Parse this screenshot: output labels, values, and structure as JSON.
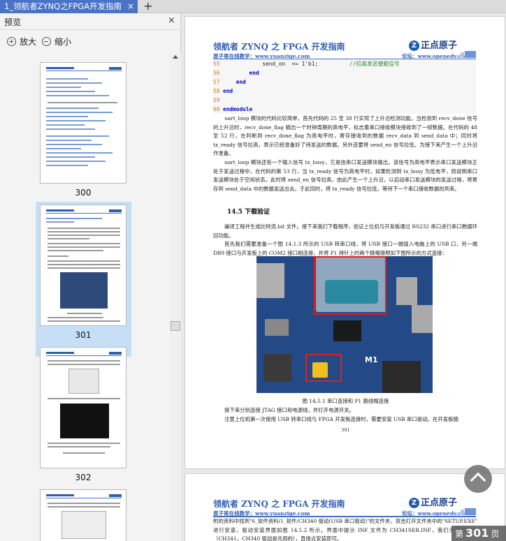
{
  "tab": {
    "title": "1_领航者ZYNQ之FPGA开发指南",
    "close": "×",
    "add": "+"
  },
  "panel": {
    "title": "预览",
    "close": "×",
    "zoom_in": "放大",
    "zoom_out": "缩小",
    "thumbnails": [
      {
        "page": "300",
        "selected": false
      },
      {
        "page": "301",
        "selected": true
      },
      {
        "page": "302",
        "selected": false
      }
    ]
  },
  "doc": {
    "header_title": "领航者 ZYNQ 之 FPGA 开发指南",
    "logo_text": "正点原子",
    "sub_left": "原子哥在线教学：www.yuanzige.com",
    "sub_right": "论坛：www.openedv.com",
    "code": [
      {
        "ln": "55",
        "text": "            send_on  <= 1'b1;",
        "comment": "//拉高发送使能信号"
      },
      {
        "ln": "56",
        "kw": "        end"
      },
      {
        "ln": "57",
        "kw": "    end"
      },
      {
        "ln": "58",
        "kw": "end"
      },
      {
        "ln": "59",
        "text": ""
      },
      {
        "ln": "60",
        "kw": "endmodule"
      }
    ],
    "para1": "uart_loop 模块的代码比较简单，首先代码的 25 至 38 行实现了上升沿检测功能。当检测到 recv_done 信号的上升沿时，recv_done_flag 输出一个时钟周期的高电平，标志着串口接收模块接收到了一帧数据。在代码的 48 至 52 行，在判断到 recv_done_flag 为高电平时，寄存接收到的数据 recv_data 到 send_data 中；同时将 tx_ready 信号拉高，表示已经准备好了待发送的数据。另外还要将 send_en 信号拉低，为接下来产生一个上升沿作准备。",
    "para2": "uart_loop 模块还有一个输入信号 tx_busy，它是由串口发送模块输出。该信号为高电平表示串口发送模块正处于发送过程中，在代码的第 53 行，当 tx_ready 信号为高电平时，如果检测到 tx_busy 为低电平，则说明串口发送模块处于空闲状态。此时将 send_en 信号拉高，由此产生一个上升沿，以启动串口发送模块的发送过程，将寄存到 send_data 中的数据发送出去。于此同时，将 tx_ready 信号拉低，等待下一个串口接收数据的到来。",
    "section": "14.5 下载验证",
    "para3": "编译工程并生成比特流.bit 文件。接下来我们下载程序，验证上位机与开发板通过 RS232 串口进行串口数据环回功能。",
    "para4": "首先我们需要准备一个图 14.1.3 所示的 USB 转串口线，将 USB 接口一端插入电脑上的 USB 口，另一端 DB9 接口与开发板上的 COM2 接口相连接，并将 P1 排针上的两个跳帽接照如下图所示的方式连接：",
    "photo_label": "M1",
    "caption": "图 14.5.1 串口连接和 P1 跳线帽连接",
    "para5": "接下来分别连接 JTAG 接口和电源线，并打开电源开关。",
    "para6": "注意上位机第一次使用 USB 转串口线与 FPGA 开发板连接时，需要安装 USB 串口驱动。在开发板随",
    "page_number": "301",
    "page2_para": "附的资料中找到\"6_软件资料/1_软件/CH340 驱动(USB 串口驱动)\"的文件夹，双击打开文件夹中的\"SETUP.EXE\" 进行安装，驱动安装界面如图 14.5.2 所示。界面中提示 INF 文件为 CH341SER.INF，我们无需要理会（CH341，CH340 驱动是共用的），直接点安装即可。"
  },
  "page_badge": {
    "prefix": "第",
    "number": "301",
    "suffix": "页"
  },
  "colors": {
    "accent": "#4a73c8",
    "header_blue": "#3460b8",
    "selection": "#c7dff6"
  }
}
